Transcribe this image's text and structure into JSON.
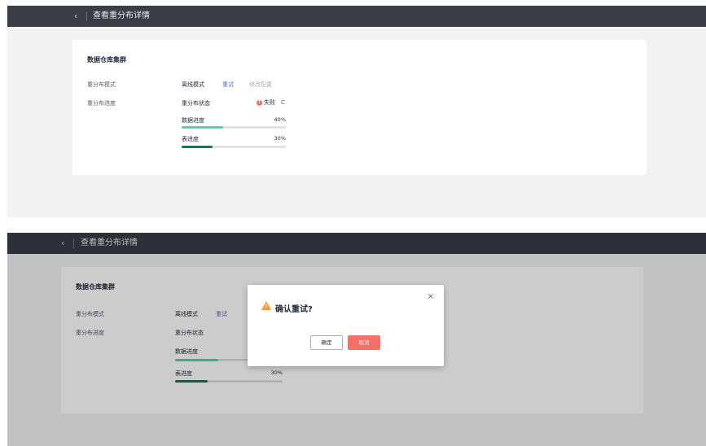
{
  "header": {
    "back_icon": "‹",
    "title": "查看重分布详情"
  },
  "card": {
    "title": "数据仓库集群",
    "mode_label": "重分布模式",
    "mode_value": "离线模式",
    "retry_link": "重试",
    "modify_config_link": "修改配置",
    "progress_label": "重分布进度",
    "status_label": "重分布状态",
    "status_value": "失败",
    "data_progress_label": "数据进度",
    "data_progress_value": "40%",
    "data_progress_fraction": 0.4,
    "table_progress_label": "表进度",
    "table_progress_value": "30%",
    "table_progress_fraction": 0.3
  },
  "dialog": {
    "title": "确认重试?",
    "ok_label": "确定",
    "cancel_label": "取消",
    "close_icon": "×"
  },
  "colors": {
    "header_bg": "#3a3d48",
    "link": "#526ecc",
    "error": "#f66f6a",
    "warning": "#fa9841",
    "data_progress": "#50d4ab",
    "table_progress": "#0a7a57"
  }
}
